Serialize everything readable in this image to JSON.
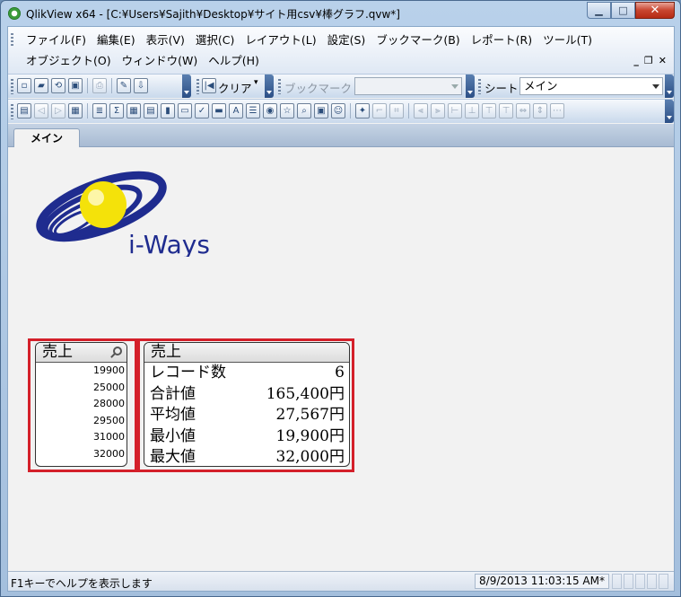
{
  "window": {
    "title": "QlikView x64 - [C:¥Users¥Sajith¥Desktop¥サイト用csv¥棒グラフ.qvw*]"
  },
  "menu": {
    "row1": [
      "ファイル(F)",
      "編集(E)",
      "表示(V)",
      "選択(C)",
      "レイアウト(L)",
      "設定(S)",
      "ブックマーク(B)",
      "レポート(R)",
      "ツール(T)"
    ],
    "row2": [
      "オブジェクト(O)",
      "ウィンドウ(W)",
      "ヘルプ(H)"
    ]
  },
  "toolbar": {
    "clear_label": "クリア",
    "bookmark_label": "ブックマーク",
    "bookmark_value": "",
    "sheet_label": "シート",
    "sheet_value": "メイン"
  },
  "tabs": [
    "メイン"
  ],
  "logo": {
    "text": "i-Ways"
  },
  "listbox": {
    "title": "売上",
    "values": [
      "19900",
      "25000",
      "28000",
      "29500",
      "31000",
      "32000"
    ]
  },
  "stats": {
    "title": "売上",
    "rows": [
      {
        "label": "レコード数",
        "value": "6"
      },
      {
        "label": "合計値",
        "value": "165,400円"
      },
      {
        "label": "平均値",
        "value": "27,567円"
      },
      {
        "label": "最小値",
        "value": "19,900円"
      },
      {
        "label": "最大値",
        "value": "32,000円"
      }
    ]
  },
  "status": {
    "help_text": "F1キーでヘルプを表示します",
    "timestamp": "8/9/2013 11:03:15 AM*"
  },
  "colors": {
    "highlight": "#d4202a",
    "logo_blue": "#1f2c8f",
    "logo_yellow": "#f4e20a"
  }
}
